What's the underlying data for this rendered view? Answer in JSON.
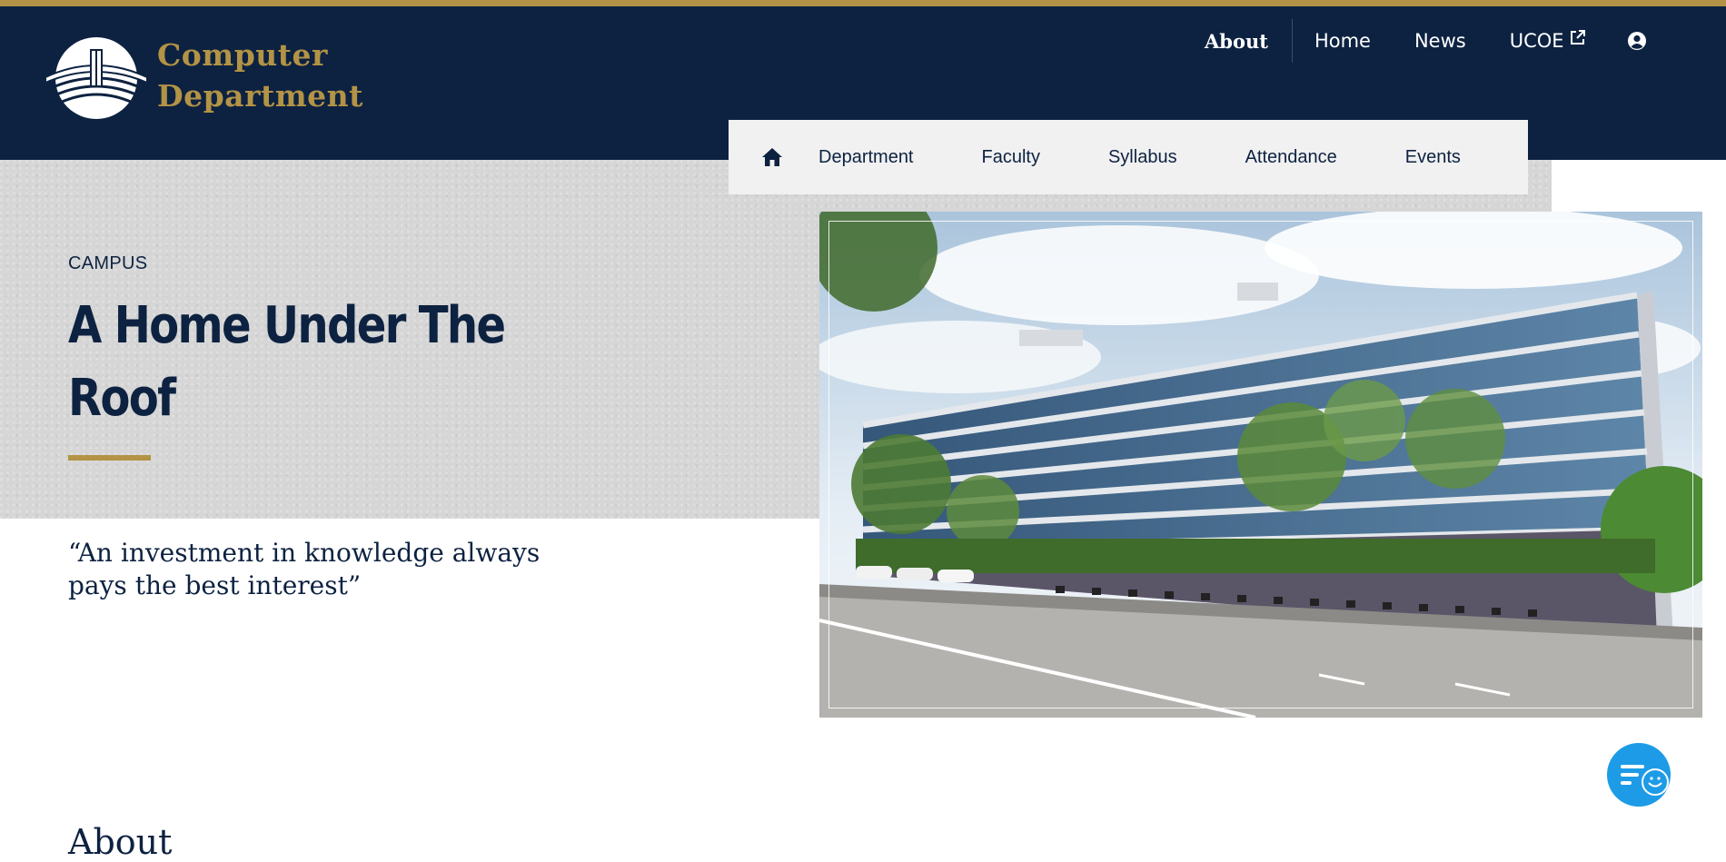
{
  "brand": {
    "line1": "Computer",
    "line2": "Department"
  },
  "topnav": {
    "about": "About",
    "home": "Home",
    "news": "News",
    "ucoe": "UCOE"
  },
  "subnav": {
    "items": [
      "Department",
      "Faculty",
      "Syllabus",
      "Attendance",
      "Events"
    ]
  },
  "hero": {
    "kicker": "CAMPUS",
    "headline_line1": "A Home Under The",
    "headline_line2": "Roof",
    "quote_line1": "“An investment in knowledge always",
    "quote_line2": "pays the best interest”"
  },
  "section": {
    "about_heading": "About"
  },
  "colors": {
    "navy": "#0d2241",
    "gold": "#b39345",
    "chat": "#1e9be6"
  },
  "icons": [
    "home-icon",
    "external-link-icon",
    "user-icon",
    "chat-icon"
  ]
}
